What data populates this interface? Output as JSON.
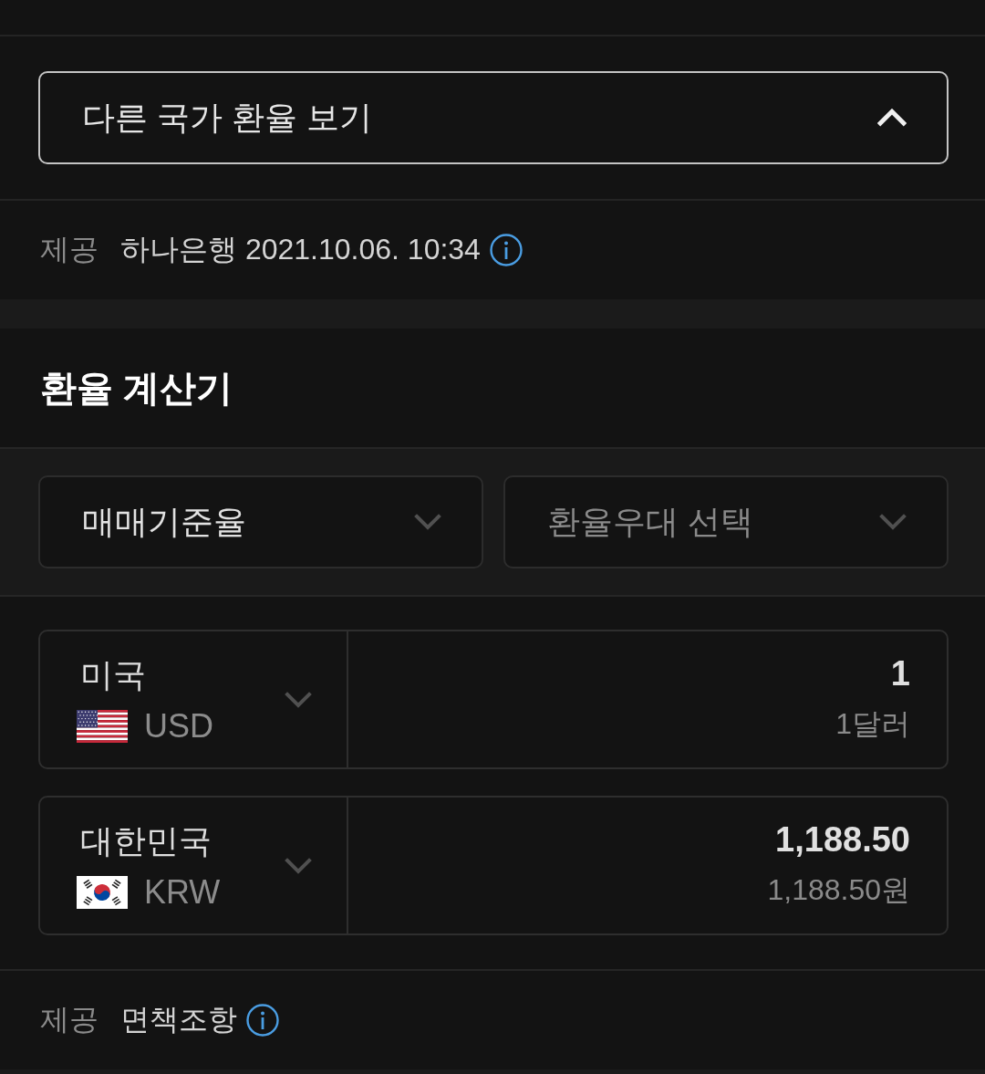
{
  "country_rates_toggle": {
    "label": "다른 국가 환율 보기",
    "expanded": true
  },
  "rate_source": {
    "label": "제공",
    "provider": "하나은행 2021.10.06. 10:34"
  },
  "calculator": {
    "title": "환율 계산기",
    "selects": [
      {
        "value": "매매기준율"
      },
      {
        "placeholder": "환율우대 선택"
      }
    ],
    "rows": [
      {
        "country": "미국",
        "kind": "us",
        "currency": "USD",
        "amount": "1",
        "amount_text": "1달러"
      },
      {
        "country": "대한민국",
        "kind": "kr",
        "currency": "KRW",
        "amount": "1,188.50",
        "amount_text": "1,188.50원"
      }
    ]
  },
  "disclaimer": {
    "label": "제공",
    "link": "면책조항"
  }
}
